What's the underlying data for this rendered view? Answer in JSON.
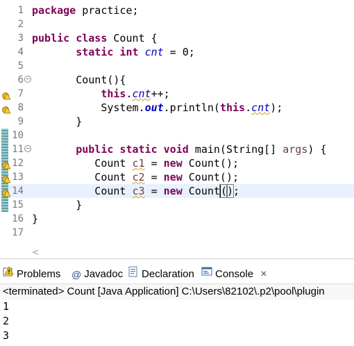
{
  "editor": {
    "lines": [
      {
        "num": "1",
        "tokens": [
          {
            "t": "package",
            "c": "kw"
          },
          {
            "t": " practice;",
            "c": ""
          }
        ]
      },
      {
        "num": "2",
        "tokens": []
      },
      {
        "num": "3",
        "tokens": [
          {
            "t": "public",
            "c": "kw"
          },
          {
            "t": " ",
            "c": ""
          },
          {
            "t": "class",
            "c": "kw"
          },
          {
            "t": " Count {",
            "c": ""
          }
        ]
      },
      {
        "num": "4",
        "tokens": [
          {
            "t": "       ",
            "c": ""
          },
          {
            "t": "static",
            "c": "kw"
          },
          {
            "t": " ",
            "c": ""
          },
          {
            "t": "int",
            "c": "kw"
          },
          {
            "t": " ",
            "c": ""
          },
          {
            "t": "cnt",
            "c": "fld"
          },
          {
            "t": " = 0;",
            "c": ""
          }
        ]
      },
      {
        "num": "5",
        "tokens": []
      },
      {
        "num": "6",
        "fold": true,
        "tokens": [
          {
            "t": "       Count(){",
            "c": ""
          }
        ]
      },
      {
        "num": "7",
        "warn": true,
        "tokens": [
          {
            "t": "           ",
            "c": ""
          },
          {
            "t": "this",
            "c": "kw"
          },
          {
            "t": ".",
            "c": ""
          },
          {
            "t": "cnt",
            "c": "fld squig"
          },
          {
            "t": "++;",
            "c": ""
          }
        ]
      },
      {
        "num": "8",
        "warn": true,
        "tokens": [
          {
            "t": "           System.",
            "c": ""
          },
          {
            "t": "out",
            "c": "fldb"
          },
          {
            "t": ".println(",
            "c": ""
          },
          {
            "t": "this",
            "c": "kw"
          },
          {
            "t": ".",
            "c": ""
          },
          {
            "t": "cnt",
            "c": "fld squig"
          },
          {
            "t": ");",
            "c": ""
          }
        ]
      },
      {
        "num": "9",
        "tokens": [
          {
            "t": "       }",
            "c": ""
          }
        ]
      },
      {
        "num": "10",
        "change": true,
        "tokens": []
      },
      {
        "num": "11",
        "fold": true,
        "change": true,
        "tokens": [
          {
            "t": "       ",
            "c": ""
          },
          {
            "t": "public",
            "c": "kw"
          },
          {
            "t": " ",
            "c": ""
          },
          {
            "t": "static",
            "c": "kw"
          },
          {
            "t": " ",
            "c": ""
          },
          {
            "t": "void",
            "c": "kw"
          },
          {
            "t": " main(String[] ",
            "c": ""
          },
          {
            "t": "args",
            "c": "var"
          },
          {
            "t": ") {",
            "c": ""
          }
        ]
      },
      {
        "num": "12",
        "warn": true,
        "change": true,
        "tokens": [
          {
            "t": "          Count ",
            "c": ""
          },
          {
            "t": "c1",
            "c": "var squig"
          },
          {
            "t": " = ",
            "c": ""
          },
          {
            "t": "new",
            "c": "kw"
          },
          {
            "t": " Count();",
            "c": ""
          }
        ]
      },
      {
        "num": "13",
        "warn": true,
        "change": true,
        "tokens": [
          {
            "t": "          Count ",
            "c": ""
          },
          {
            "t": "c2",
            "c": "var squig"
          },
          {
            "t": " = ",
            "c": ""
          },
          {
            "t": "new",
            "c": "kw"
          },
          {
            "t": " Count();",
            "c": ""
          }
        ]
      },
      {
        "num": "14",
        "warn": true,
        "change": true,
        "current": true,
        "tokens": [
          {
            "t": "          Count ",
            "c": ""
          },
          {
            "t": "c3",
            "c": "var squig"
          },
          {
            "t": " = ",
            "c": ""
          },
          {
            "t": "new",
            "c": "kw"
          },
          {
            "t": " Count",
            "c": ""
          },
          {
            "t": "(",
            "c": "cursor bracket"
          },
          {
            "t": ")",
            "c": "bracket"
          },
          {
            "t": ";",
            "c": ""
          }
        ]
      },
      {
        "num": "15",
        "change": true,
        "tokens": [
          {
            "t": "       }",
            "c": ""
          }
        ]
      },
      {
        "num": "16",
        "tokens": [
          {
            "t": "}",
            "c": ""
          }
        ]
      },
      {
        "num": "17",
        "tokens": []
      }
    ],
    "scroll_left_glyph": "<"
  },
  "tabs": [
    {
      "label": "Problems",
      "icon": "problems-icon",
      "active": false
    },
    {
      "label": "Javadoc",
      "icon": "at-icon",
      "active": false
    },
    {
      "label": "Declaration",
      "icon": "declaration-icon",
      "active": false
    },
    {
      "label": "Console",
      "icon": "console-icon",
      "active": true
    }
  ],
  "tab_close_glyph": "×",
  "console": {
    "status": "<terminated> Count [Java Application] C:\\Users\\82102\\.p2\\pool\\plugin",
    "output": [
      "1",
      "2",
      "3"
    ]
  },
  "colors": {
    "keyword": "#7f0055",
    "field": "#0000c0",
    "local_var": "#6a3e3e",
    "current_line": "#e8f2fe"
  }
}
